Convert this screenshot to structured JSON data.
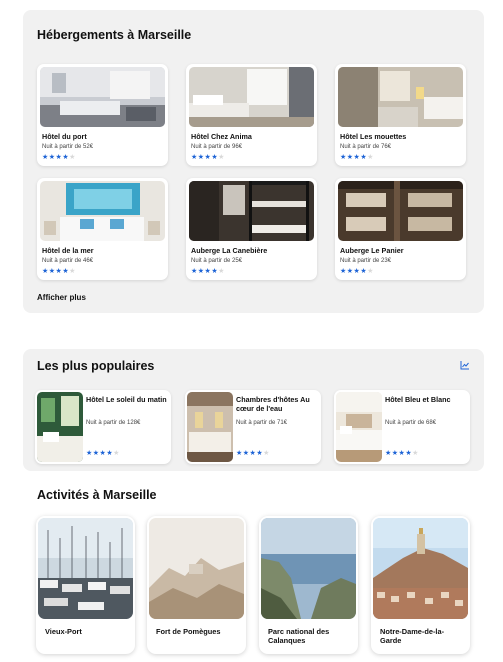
{
  "hebergements": {
    "title": "Hébergements à Marseille",
    "show_more": "Afficher plus",
    "hotels": [
      {
        "name": "Hôtel du port",
        "price": "Nuit à partir de 52€",
        "stars": 4
      },
      {
        "name": "Hôtel Chez Anima",
        "price": "Nuit à partir de 96€",
        "stars": 4
      },
      {
        "name": "Hôtel Les mouettes",
        "price": "Nuit à partir de 76€",
        "stars": 4
      },
      {
        "name": "Hôtel de la mer",
        "price": "Nuit à partir de 46€",
        "stars": 4
      },
      {
        "name": "Auberge La Canebière",
        "price": "Nuit à partir de 25€",
        "stars": 4
      },
      {
        "name": "Auberge Le Panier",
        "price": "Nuit à partir de 23€",
        "stars": 4
      }
    ]
  },
  "populaires": {
    "title": "Les plus populaires",
    "icon": "trend-chart-icon",
    "items": [
      {
        "name": "Hôtel Le soleil du matin",
        "price": "Nuit à partir de 128€",
        "stars": 4
      },
      {
        "name": "Chambres d'hôtes Au cœur de l'eau",
        "price": "Nuit à partir de 71€",
        "stars": 4
      },
      {
        "name": "Hôtel Bleu et Blanc",
        "price": "Nuit à partir de 68€",
        "stars": 4
      }
    ]
  },
  "activites": {
    "title": "Activités à Marseille",
    "items": [
      {
        "name": "Vieux-Port"
      },
      {
        "name": "Fort de Pomègues"
      },
      {
        "name": "Parc national des Calanques"
      },
      {
        "name": "Notre-Dame-de-la-Garde"
      }
    ]
  },
  "colors": {
    "star_active": "#1e64d6",
    "star_inactive": "#d9d9d9",
    "panel_bg": "#f1f1f1"
  }
}
